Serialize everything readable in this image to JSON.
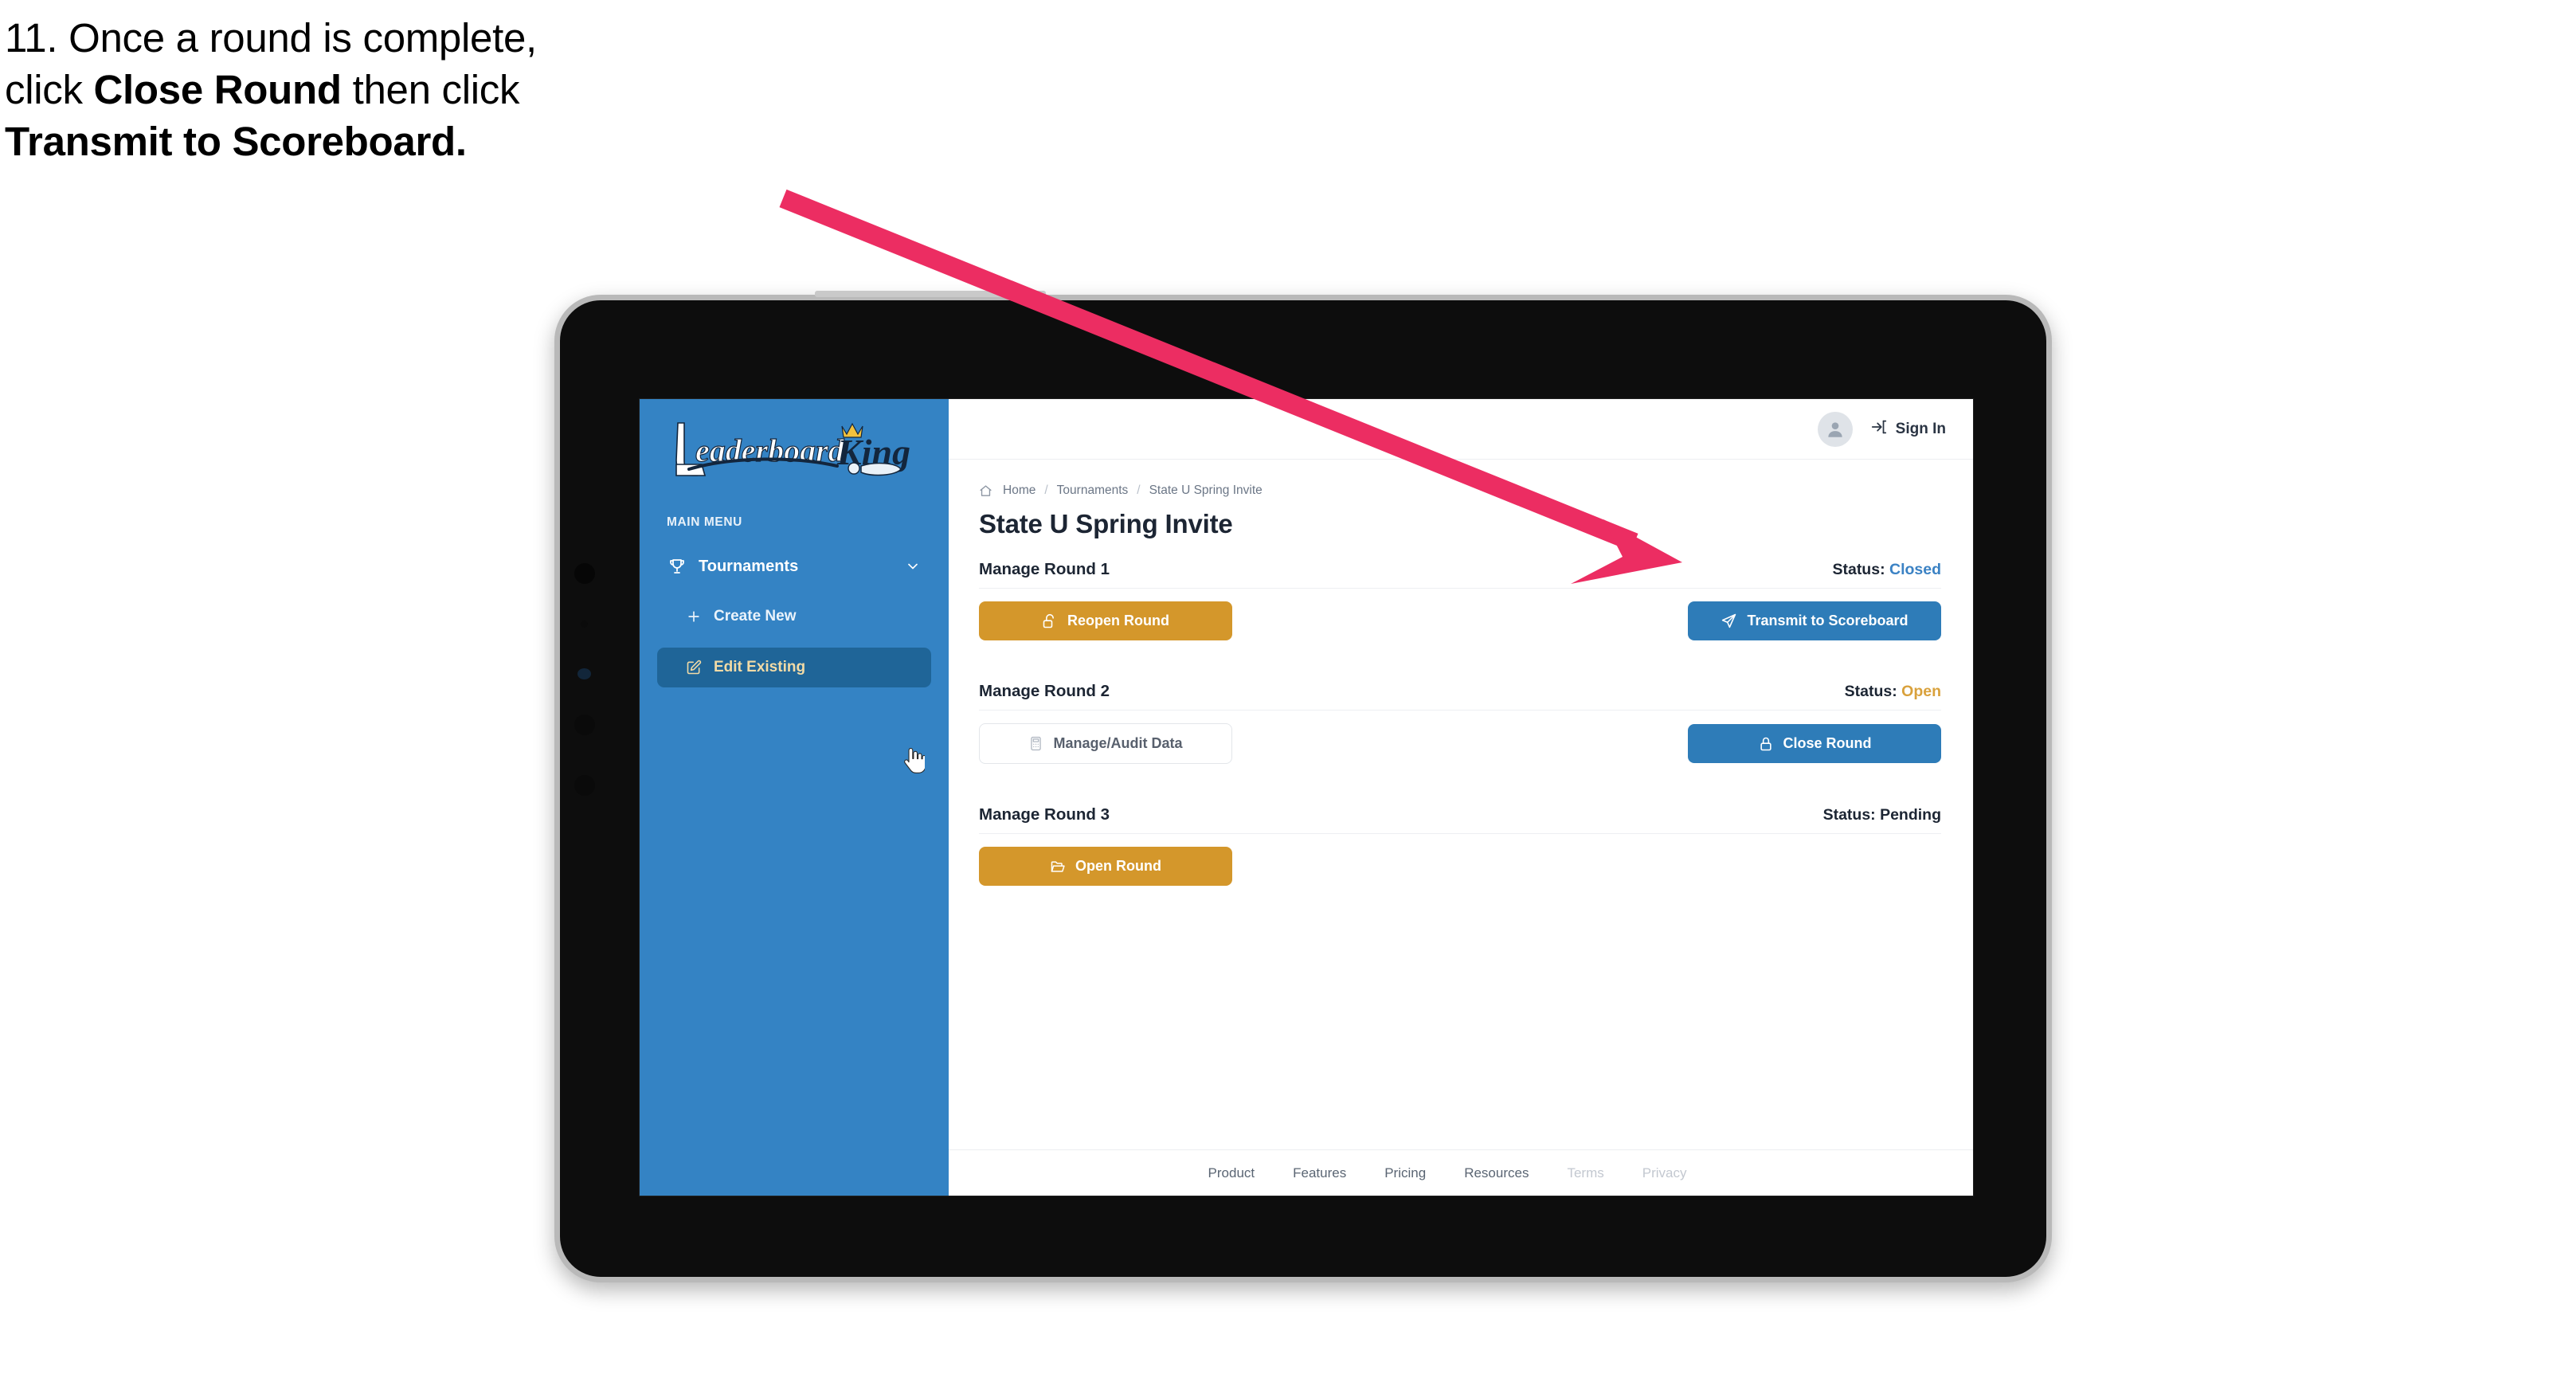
{
  "caption": {
    "line1": "11. Once a round is complete,",
    "line2_a": "click ",
    "line2_b": "Close Round",
    "line2_c": " then click",
    "line3": "Transmit to Scoreboard."
  },
  "colors": {
    "accent_blue": "#2e7cb8",
    "accent_gold": "#d4972b",
    "sidebar_blue": "#3483c4",
    "sidebar_active": "#1f6598",
    "arrow_pink": "#ec2d62",
    "status_closed": "#3b82c4",
    "status_open": "#d9a13c",
    "text_dark": "#1c2533"
  },
  "sidebar": {
    "logo_primary": "Leaderboard",
    "logo_secondary": "King",
    "menu_label": "MAIN MENU",
    "items": [
      {
        "label": "Tournaments",
        "icon": "trophy-icon",
        "chevron": "chevron-down-icon",
        "active": false
      },
      {
        "label": "Create New",
        "icon": "plus-icon",
        "active": false
      },
      {
        "label": "Edit Existing",
        "icon": "edit-icon",
        "active": true
      }
    ]
  },
  "topbar": {
    "avatar_icon": "user-avatar-icon",
    "signin_icon": "sign-in-arrow-icon",
    "signin_label": "Sign In"
  },
  "breadcrumb": {
    "home_icon": "home-icon",
    "items": [
      "Home",
      "Tournaments",
      "State U Spring Invite"
    ],
    "separator": "/"
  },
  "page": {
    "title": "State U Spring Invite"
  },
  "rounds": [
    {
      "name": "Manage Round 1",
      "status_label": "Status:",
      "status_value": "Closed",
      "status_kind": "closed",
      "left_button": {
        "label": "Reopen Round",
        "icon": "unlock-icon",
        "style": "gold"
      },
      "right_button": {
        "label": "Transmit to Scoreboard",
        "icon": "paper-plane-icon",
        "style": "blue"
      }
    },
    {
      "name": "Manage Round 2",
      "status_label": "Status:",
      "status_value": "Open",
      "status_kind": "open",
      "left_button": {
        "label": "Manage/Audit Data",
        "icon": "calculator-icon",
        "style": "ghost"
      },
      "right_button": {
        "label": "Close Round",
        "icon": "lock-icon",
        "style": "blue"
      }
    },
    {
      "name": "Manage Round 3",
      "status_label": "Status:",
      "status_value": "Pending",
      "status_kind": "pending",
      "left_button": {
        "label": "Open Round",
        "icon": "open-folder-icon",
        "style": "gold"
      },
      "right_button": null
    }
  ],
  "footer": {
    "links": [
      {
        "label": "Product",
        "dim": false
      },
      {
        "label": "Features",
        "dim": false
      },
      {
        "label": "Pricing",
        "dim": false
      },
      {
        "label": "Resources",
        "dim": false
      },
      {
        "label": "Terms",
        "dim": true
      },
      {
        "label": "Privacy",
        "dim": true
      }
    ]
  },
  "annotation": {
    "arrow_name": "pink-pointer-arrow",
    "points_to": "Transmit to Scoreboard"
  }
}
